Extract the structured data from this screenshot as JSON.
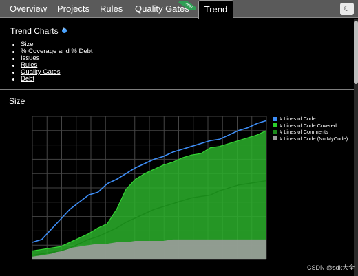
{
  "tabs": [
    {
      "label": "Overview"
    },
    {
      "label": "Projects"
    },
    {
      "label": "Rules"
    },
    {
      "label": "Quality Gates",
      "ribbon": "new"
    },
    {
      "label": "Trend",
      "active": true
    }
  ],
  "theme_button_icon": "moon-icon",
  "header": {
    "title": "Trend Charts",
    "links": [
      "Size",
      "% Coverage and % Debt",
      "Issues",
      "Rules",
      "Quality Gates",
      "Debt"
    ]
  },
  "section": {
    "title": "Size"
  },
  "chart_data": {
    "type": "area",
    "title": "Size",
    "grid": true,
    "legend_position": "right",
    "ylim": [
      0,
      100
    ],
    "x": [
      0,
      4,
      8,
      12,
      16,
      20,
      24,
      28,
      32,
      36,
      40,
      44,
      48,
      52,
      56,
      60,
      64,
      68,
      72,
      76,
      80,
      84,
      88,
      92,
      96,
      100
    ],
    "series": [
      {
        "name": "# Lines of Code",
        "color": "#3e8ef7",
        "style": "line",
        "values": [
          12,
          14,
          21,
          28,
          35,
          40,
          45,
          47,
          53,
          56,
          60,
          64,
          67,
          70,
          72,
          75,
          77,
          79,
          81,
          83,
          84,
          87,
          90,
          92,
          95,
          97
        ]
      },
      {
        "name": "# Lines of Code Covered",
        "color": "#2bb02b",
        "style": "area",
        "values": [
          6,
          7,
          8,
          9,
          12,
          15,
          18,
          22,
          25,
          35,
          49,
          56,
          60,
          63,
          66,
          68,
          71,
          73,
          74,
          78,
          79,
          81,
          83,
          85,
          87,
          90
        ]
      },
      {
        "name": "# Lines of Comments",
        "color": "#1a8a1a",
        "style": "line",
        "values": [
          3,
          4,
          5,
          6,
          8,
          11,
          14,
          16,
          19,
          22,
          26,
          29,
          32,
          35,
          37,
          39,
          41,
          43,
          44,
          45,
          48,
          50,
          52,
          53,
          54,
          55
        ]
      },
      {
        "name": "# Lines of Code (NotMyCode)",
        "color": "#9c9c9c",
        "style": "area",
        "values": [
          2,
          3,
          4,
          6,
          8,
          9,
          10,
          11,
          11,
          12,
          12,
          13,
          13,
          13,
          13,
          14,
          14,
          14,
          14,
          14,
          14,
          14,
          14,
          14,
          14,
          14
        ]
      }
    ]
  },
  "watermark": "CSDN @sdk大全"
}
